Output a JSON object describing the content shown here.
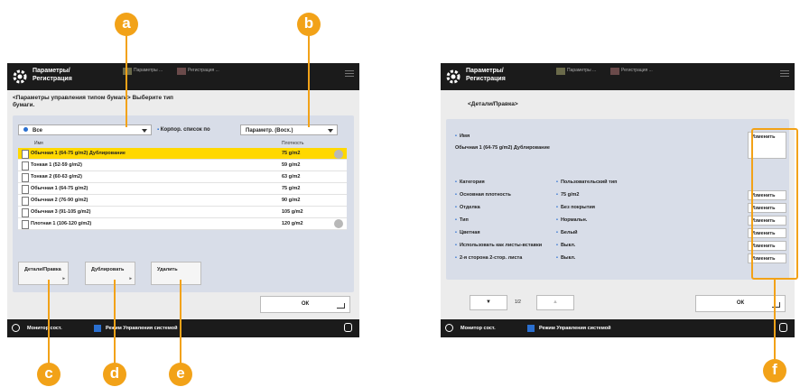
{
  "left": {
    "header": {
      "title": "Параметры/ Регистрация",
      "icon1_label": "Параметры ...",
      "icon2_label": "Регистрация ..."
    },
    "instructions": "<Параметры управления типом бумаги> Выберите тип бумаги.",
    "filter_all": "Все",
    "filter_custom_label": "Корпор. список по",
    "filter_sort": "Параметр. (Восх.)",
    "col_name": "Имя",
    "col_weight": "Плотность",
    "rows": [
      {
        "name": "Обычная 1 (64-75 g/m2) Дублирование",
        "weight": "75 g/m2"
      },
      {
        "name": "Тонкая 1 (52-59 g/m2)",
        "weight": "59 g/m2"
      },
      {
        "name": "Тонкая 2 (60-63 g/m2)",
        "weight": "63 g/m2"
      },
      {
        "name": "Обычная 1 (64-75 g/m2)",
        "weight": "75 g/m2"
      },
      {
        "name": "Обычная 2 (76-90 g/m2)",
        "weight": "90 g/m2"
      },
      {
        "name": "Обычная 3 (91-105 g/m2)",
        "weight": "105 g/m2"
      },
      {
        "name": "Плотная 1 (106-120 g/m2)",
        "weight": "120 g/m2"
      }
    ],
    "btn_details": "Детали/Правка",
    "btn_duplicate": "Дублировать",
    "btn_delete": "Удалить",
    "ok": "ОК",
    "status_monitor": "Монитор сост.",
    "status_mode": "Режим Управления системой"
  },
  "right": {
    "header": {
      "title": "Параметры/ Регистрация",
      "icon1_label": "Параметры ...",
      "icon2_label": "Регистрация ..."
    },
    "subtitle": "<Детали/Правка>",
    "name_label": "Имя",
    "name_value": "Обычная 1 (64-75 g/m2) Дублирование",
    "props": [
      {
        "label": "Категория",
        "value": "Пользовательский тип",
        "editable": false
      },
      {
        "label": "Основная плотность",
        "value": "75 g/m2",
        "editable": true
      },
      {
        "label": "Отделка",
        "value": "Без покрытия",
        "editable": true
      },
      {
        "label": "Тип",
        "value": "Нормальн.",
        "editable": true
      },
      {
        "label": "Цветная",
        "value": "Белый",
        "editable": true
      },
      {
        "label": "Использовать как листы-вставки",
        "value": "Выкл.",
        "editable": true
      },
      {
        "label": "2-я сторона 2-стор. листа",
        "value": "Выкл.",
        "editable": true
      }
    ],
    "change": "Изменить",
    "page": "1/2",
    "ok": "ОК",
    "status_monitor": "Монитор сост.",
    "status_mode": "Режим Управления системой"
  },
  "callouts": {
    "a": "a",
    "b": "b",
    "c": "c",
    "d": "d",
    "e": "e",
    "f": "f"
  },
  "colors": {
    "accent": "#f2a218",
    "selected_row": "#ffd800",
    "header": "#1b1b1b"
  }
}
